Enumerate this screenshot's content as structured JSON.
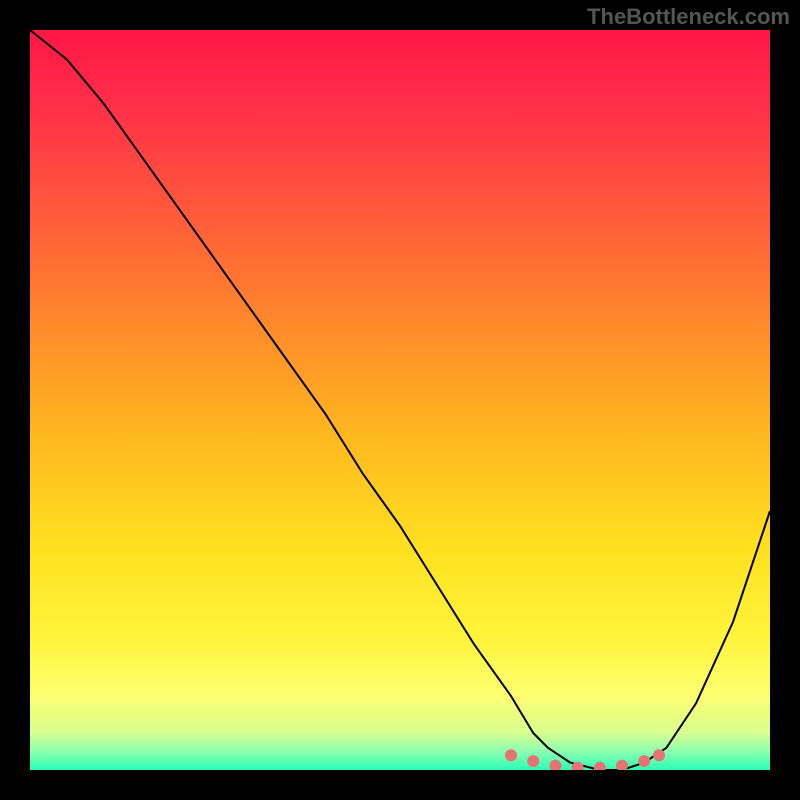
{
  "watermark": "TheBottleneck.com",
  "chart_data": {
    "type": "line",
    "title": "",
    "xlabel": "",
    "ylabel": "",
    "xlim": [
      0,
      100
    ],
    "ylim": [
      0,
      100
    ],
    "grid": false,
    "background_gradient": {
      "stops": [
        {
          "offset": 0.0,
          "color": "#ff1744"
        },
        {
          "offset": 0.1,
          "color": "#ff2e4a"
        },
        {
          "offset": 0.25,
          "color": "#ff5a3a"
        },
        {
          "offset": 0.4,
          "color": "#ff8a2a"
        },
        {
          "offset": 0.55,
          "color": "#ffb81f"
        },
        {
          "offset": 0.7,
          "color": "#ffe020"
        },
        {
          "offset": 0.82,
          "color": "#fff43a"
        },
        {
          "offset": 0.9,
          "color": "#fdff70"
        },
        {
          "offset": 0.95,
          "color": "#d8ff8f"
        },
        {
          "offset": 0.975,
          "color": "#8cffb0"
        },
        {
          "offset": 1.0,
          "color": "#2bffb5"
        }
      ]
    },
    "series": [
      {
        "name": "bottleneck-curve",
        "color": "#000000",
        "width": 2,
        "x": [
          0,
          5,
          10,
          15,
          20,
          25,
          30,
          35,
          40,
          45,
          50,
          55,
          60,
          65,
          68,
          70,
          73,
          77,
          80,
          83,
          86,
          90,
          95,
          100
        ],
        "y": [
          100,
          96,
          90,
          83,
          76,
          69,
          62,
          55,
          48,
          40,
          33,
          25,
          17,
          10,
          5,
          3,
          1,
          0,
          0,
          1,
          3,
          9,
          20,
          35
        ]
      },
      {
        "name": "highlight-dots",
        "color": "#e57373",
        "type": "scatter",
        "marker_size": 6,
        "x": [
          65,
          68,
          71,
          74,
          77,
          80,
          83,
          85
        ],
        "y": [
          2,
          1.2,
          0.6,
          0.3,
          0.3,
          0.6,
          1.2,
          2
        ]
      }
    ]
  }
}
